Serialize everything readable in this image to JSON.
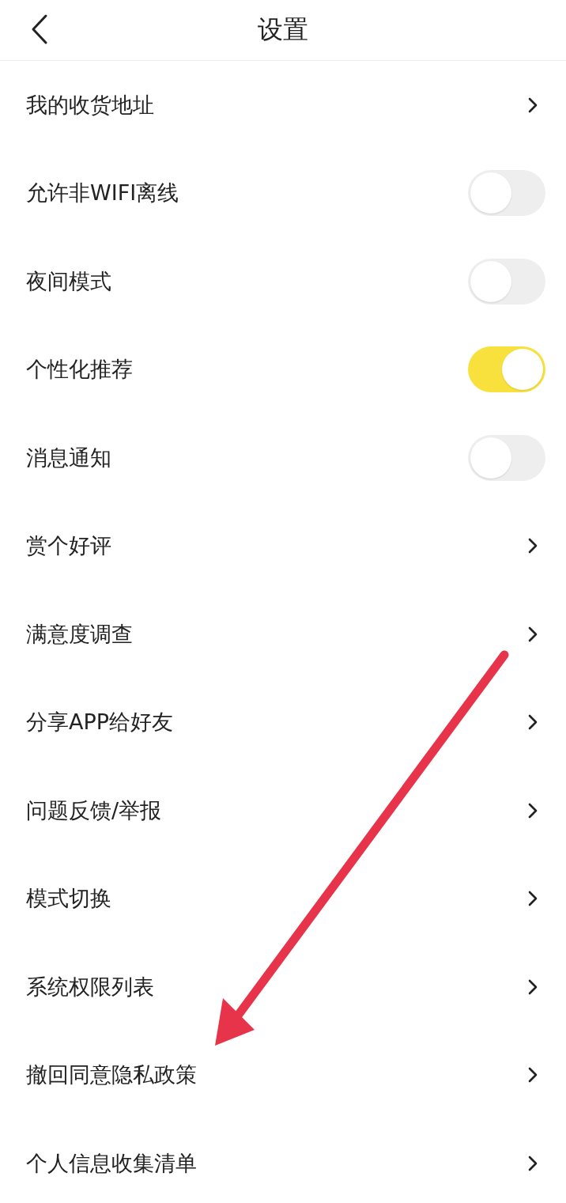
{
  "header": {
    "title": "设置"
  },
  "rows": [
    {
      "label": "我的收货地址",
      "kind": "link"
    },
    {
      "label": "允许非WIFI离线",
      "kind": "toggle",
      "on": false
    },
    {
      "label": "夜间模式",
      "kind": "toggle",
      "on": false
    },
    {
      "label": "个性化推荐",
      "kind": "toggle",
      "on": true
    },
    {
      "label": "消息通知",
      "kind": "toggle",
      "on": false
    },
    {
      "label": "赏个好评",
      "kind": "link"
    },
    {
      "label": "满意度调查",
      "kind": "link"
    },
    {
      "label": "分享APP给好友",
      "kind": "link"
    },
    {
      "label": "问题反馈/举报",
      "kind": "link"
    },
    {
      "label": "模式切换",
      "kind": "link"
    },
    {
      "label": "系统权限列表",
      "kind": "link"
    },
    {
      "label": "撤回同意隐私政策",
      "kind": "link"
    },
    {
      "label": "个人信息收集清单",
      "kind": "link"
    }
  ]
}
